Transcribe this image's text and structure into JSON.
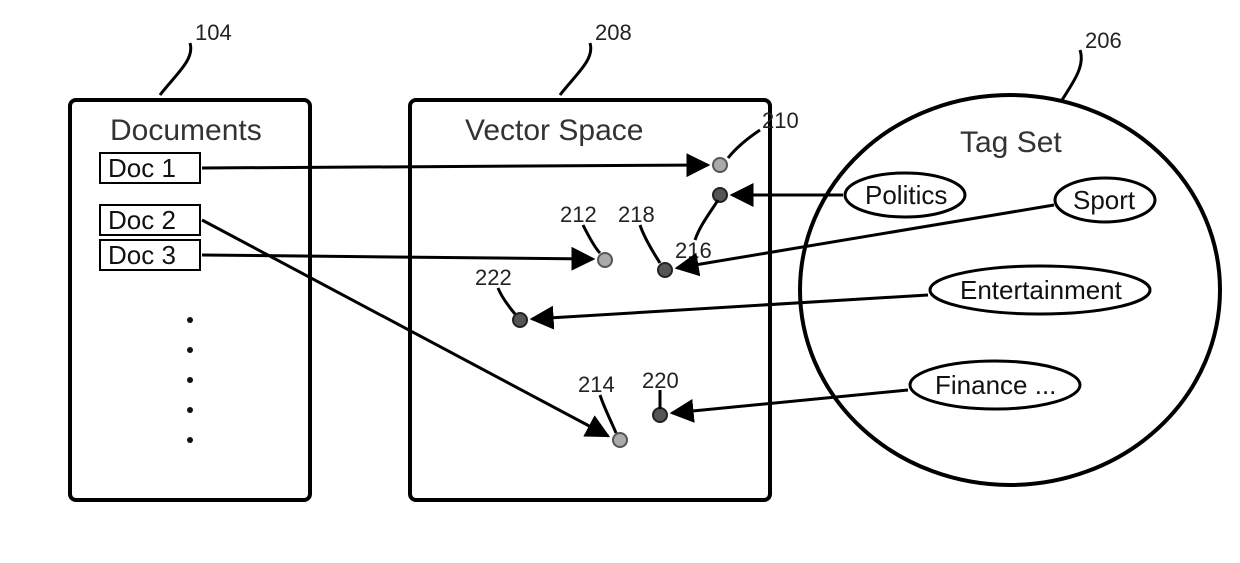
{
  "refs": {
    "documents": "104",
    "vectorSpace": "208",
    "tagSet": "206",
    "p210": "210",
    "p212": "212",
    "p214": "214",
    "p216": "216",
    "p218": "218",
    "p220": "220",
    "p222": "222"
  },
  "documentsBox": {
    "title": "Documents",
    "items": [
      "Doc 1",
      "Doc 2",
      "Doc 3"
    ]
  },
  "vectorBox": {
    "title": "Vector Space"
  },
  "tagSet": {
    "title": "Tag Set",
    "tags": {
      "politics": "Politics",
      "sport": "Sport",
      "entertainment": "Entertainment",
      "finance": "Finance ..."
    }
  }
}
